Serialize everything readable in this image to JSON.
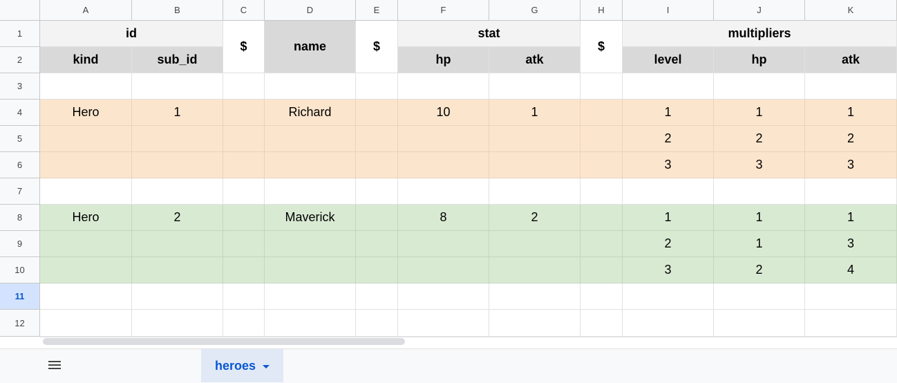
{
  "columns": [
    "A",
    "B",
    "C",
    "D",
    "E",
    "F",
    "G",
    "H",
    "I",
    "J",
    "K"
  ],
  "rows": [
    "1",
    "2",
    "3",
    "4",
    "5",
    "6",
    "7",
    "8",
    "9",
    "10",
    "11",
    "12"
  ],
  "selected_row": "11",
  "header": {
    "id": "id",
    "kind": "kind",
    "sub_id": "sub_id",
    "dollar": "$",
    "name": "name",
    "stat": "stat",
    "hp": "hp",
    "atk": "atk",
    "multipliers": "multipliers",
    "level": "level"
  },
  "heroes": [
    {
      "kind": "Hero",
      "sub_id": "1",
      "name": "Richard",
      "hp": "10",
      "atk": "1",
      "multipliers": [
        {
          "level": "1",
          "hp": "1",
          "atk": "1"
        },
        {
          "level": "2",
          "hp": "2",
          "atk": "2"
        },
        {
          "level": "3",
          "hp": "3",
          "atk": "3"
        }
      ]
    },
    {
      "kind": "Hero",
      "sub_id": "2",
      "name": "Maverick",
      "hp": "8",
      "atk": "2",
      "multipliers": [
        {
          "level": "1",
          "hp": "1",
          "atk": "1"
        },
        {
          "level": "2",
          "hp": "1",
          "atk": "3"
        },
        {
          "level": "3",
          "hp": "2",
          "atk": "4"
        }
      ]
    }
  ],
  "sheet_tab": {
    "label": "heroes"
  },
  "colors": {
    "hero_1_fill": "#fce5cd",
    "hero_2_fill": "#d9ead3",
    "header_fill": "#d9d9d9",
    "selection": "#d3e3fd"
  }
}
